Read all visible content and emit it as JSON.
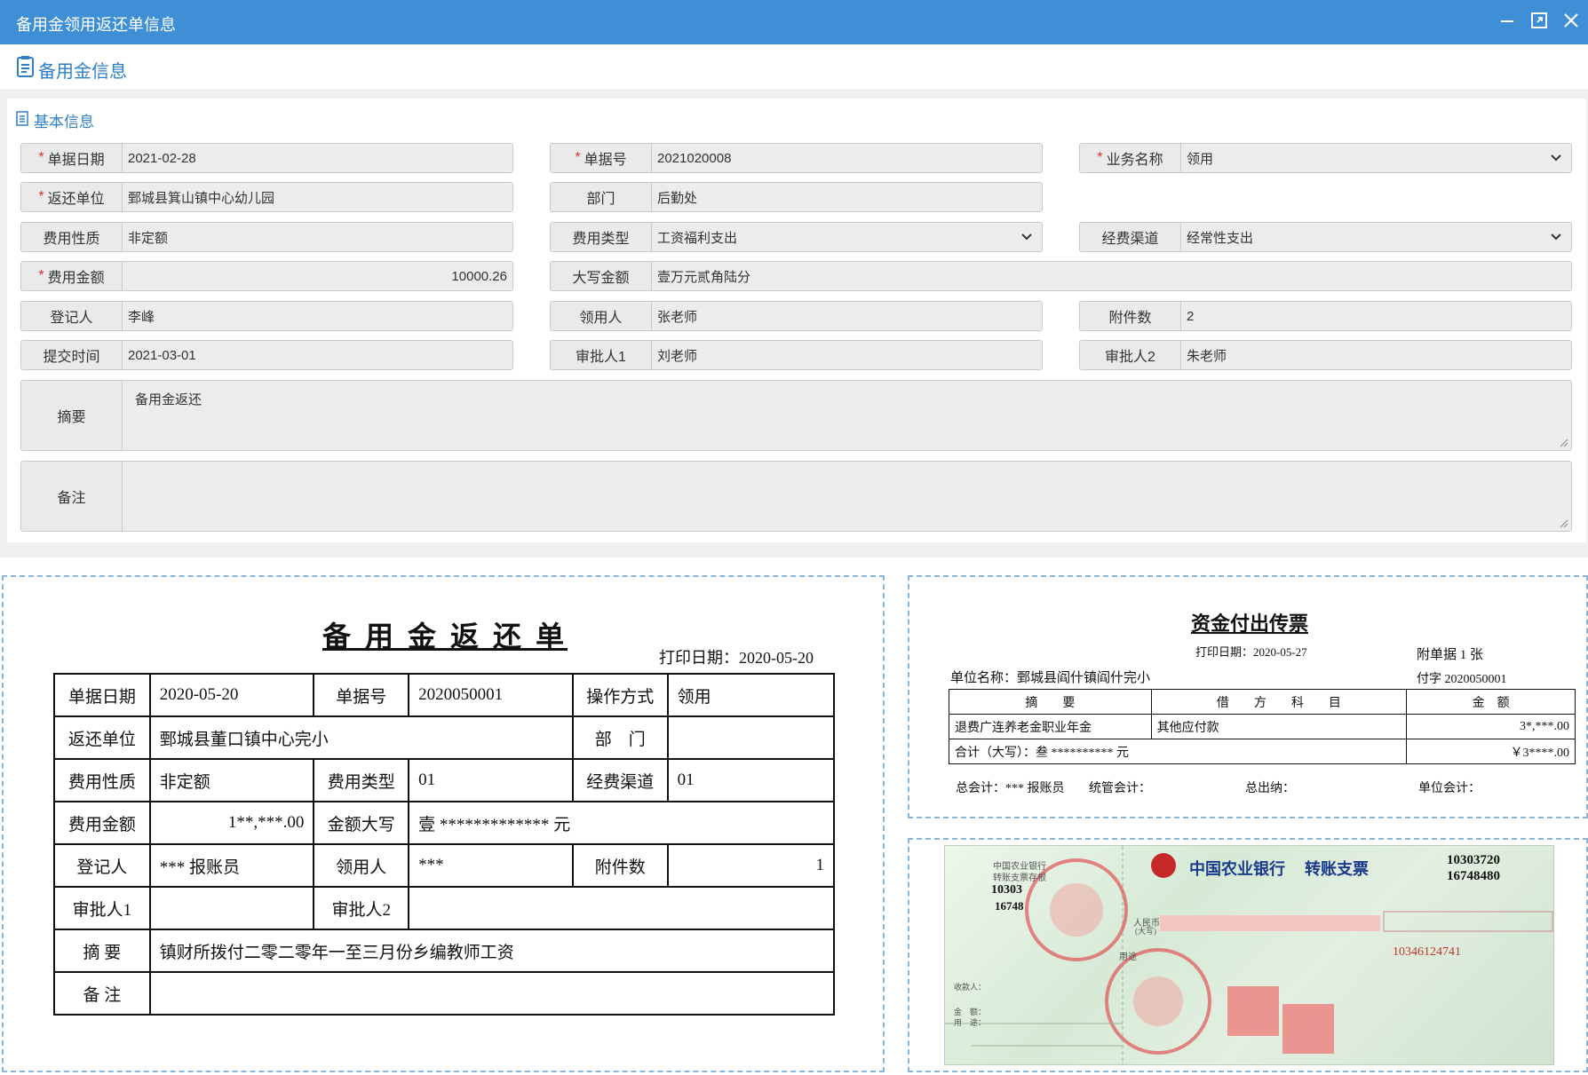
{
  "window": {
    "title": "备用金领用返还单信息"
  },
  "header": {
    "title": "备用金信息"
  },
  "section": {
    "title": "基本信息"
  },
  "fields": {
    "date": {
      "label": "单据日期",
      "value": "2021-02-28",
      "required": "*"
    },
    "no": {
      "label": "单据号",
      "value": "2021020008",
      "required": "*"
    },
    "biz": {
      "label": "业务名称",
      "value": "领用",
      "required": "*"
    },
    "unit": {
      "label": "返还单位",
      "value": "鄄城县箕山镇中心幼儿园",
      "required": "*"
    },
    "dept": {
      "label": "部门",
      "value": "后勤处"
    },
    "nature": {
      "label": "费用性质",
      "value": "非定额"
    },
    "type": {
      "label": "费用类型",
      "value": "工资福利支出"
    },
    "channel": {
      "label": "经费渠道",
      "value": "经常性支出"
    },
    "amount": {
      "label": "费用金额",
      "value": "10000.26",
      "required": "*"
    },
    "capital": {
      "label": "大写金额",
      "value": "壹万元贰角陆分"
    },
    "registrar": {
      "label": "登记人",
      "value": "李峰"
    },
    "recipient": {
      "label": "领用人",
      "value": "张老师"
    },
    "attach": {
      "label": "附件数",
      "value": "2"
    },
    "submit": {
      "label": "提交时间",
      "value": "2021-03-01"
    },
    "approver1": {
      "label": "审批人1",
      "value": "刘老师"
    },
    "approver2": {
      "label": "审批人2",
      "value": "朱老师"
    },
    "summary": {
      "label": "摘要",
      "value": "备用金返还"
    },
    "remark": {
      "label": "备注",
      "value": ""
    }
  },
  "form_doc": {
    "title": "备 用 金 返 还 单",
    "print_date": "打印日期：2020-05-20",
    "rows": {
      "r1": [
        "单据日期",
        "2020-05-20",
        "单据号",
        "2020050001",
        "操作方式",
        "领用"
      ],
      "r2": [
        "返还单位",
        "鄄城县董口镇中心完小",
        "部　门",
        ""
      ],
      "r3": [
        "费用性质",
        "非定额",
        "费用类型",
        "01",
        "经费渠道",
        "01"
      ],
      "r4": [
        "费用金额",
        "1**,***.00",
        "金额大写",
        "壹 ************* 元"
      ],
      "r5": [
        "登记人",
        "*** 报账员",
        "领用人",
        "***",
        "附件数",
        "1"
      ],
      "r6": [
        "审批人1",
        "",
        "审批人2",
        ""
      ],
      "r7": [
        "摘 要",
        "镇财所拨付二零二零年一至三月份乡编教师工资"
      ],
      "r8": [
        "备 注",
        ""
      ]
    }
  },
  "fund_doc": {
    "title": "资金付出传票",
    "print_date": "打印日期：2020-05-27",
    "attach_note": "附单据 1 张",
    "unit_name": "单位名称：鄄城县阎什镇阎什完小",
    "voucher": "付字 2020050001",
    "headers": [
      "摘　　要",
      "借　　方　　科　　目",
      "金　额"
    ],
    "row": [
      "退费广连养老金职业年金",
      "其他应付款",
      "3*,***.00"
    ],
    "total_label": "合计（大写）：叁 ********** 元",
    "total_value": "￥3****.00",
    "footer": [
      "总会计：*** 报账员",
      "统管会计：",
      "总出纳：",
      "单位会计："
    ]
  },
  "check": {
    "bank": "中国农业银行",
    "kind": "转账支票",
    "code1": "10303720",
    "code2": "16748480",
    "stub_bank": "中国农业银行",
    "stub_kind": "转账支票存根",
    "stub_code1": "10303",
    "stub_code2": "16748",
    "rmb": "人民币",
    "rmb_sub": "(大写)",
    "purpose": "用途",
    "payee": "收款人：",
    "amount": "金　额：",
    "use": "用　途：",
    "acct_no": "10346124741"
  }
}
